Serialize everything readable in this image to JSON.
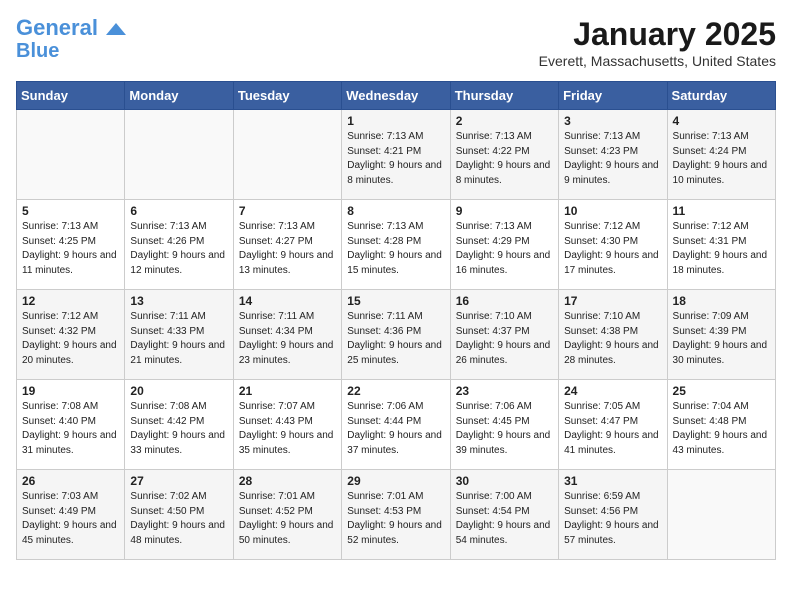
{
  "header": {
    "logo_line1": "General",
    "logo_line2": "Blue",
    "month_title": "January 2025",
    "location": "Everett, Massachusetts, United States"
  },
  "days_of_week": [
    "Sunday",
    "Monday",
    "Tuesday",
    "Wednesday",
    "Thursday",
    "Friday",
    "Saturday"
  ],
  "weeks": [
    [
      {
        "day": "",
        "content": ""
      },
      {
        "day": "",
        "content": ""
      },
      {
        "day": "",
        "content": ""
      },
      {
        "day": "1",
        "content": "Sunrise: 7:13 AM\nSunset: 4:21 PM\nDaylight: 9 hours and 8 minutes."
      },
      {
        "day": "2",
        "content": "Sunrise: 7:13 AM\nSunset: 4:22 PM\nDaylight: 9 hours and 8 minutes."
      },
      {
        "day": "3",
        "content": "Sunrise: 7:13 AM\nSunset: 4:23 PM\nDaylight: 9 hours and 9 minutes."
      },
      {
        "day": "4",
        "content": "Sunrise: 7:13 AM\nSunset: 4:24 PM\nDaylight: 9 hours and 10 minutes."
      }
    ],
    [
      {
        "day": "5",
        "content": "Sunrise: 7:13 AM\nSunset: 4:25 PM\nDaylight: 9 hours and 11 minutes."
      },
      {
        "day": "6",
        "content": "Sunrise: 7:13 AM\nSunset: 4:26 PM\nDaylight: 9 hours and 12 minutes."
      },
      {
        "day": "7",
        "content": "Sunrise: 7:13 AM\nSunset: 4:27 PM\nDaylight: 9 hours and 13 minutes."
      },
      {
        "day": "8",
        "content": "Sunrise: 7:13 AM\nSunset: 4:28 PM\nDaylight: 9 hours and 15 minutes."
      },
      {
        "day": "9",
        "content": "Sunrise: 7:13 AM\nSunset: 4:29 PM\nDaylight: 9 hours and 16 minutes."
      },
      {
        "day": "10",
        "content": "Sunrise: 7:12 AM\nSunset: 4:30 PM\nDaylight: 9 hours and 17 minutes."
      },
      {
        "day": "11",
        "content": "Sunrise: 7:12 AM\nSunset: 4:31 PM\nDaylight: 9 hours and 18 minutes."
      }
    ],
    [
      {
        "day": "12",
        "content": "Sunrise: 7:12 AM\nSunset: 4:32 PM\nDaylight: 9 hours and 20 minutes."
      },
      {
        "day": "13",
        "content": "Sunrise: 7:11 AM\nSunset: 4:33 PM\nDaylight: 9 hours and 21 minutes."
      },
      {
        "day": "14",
        "content": "Sunrise: 7:11 AM\nSunset: 4:34 PM\nDaylight: 9 hours and 23 minutes."
      },
      {
        "day": "15",
        "content": "Sunrise: 7:11 AM\nSunset: 4:36 PM\nDaylight: 9 hours and 25 minutes."
      },
      {
        "day": "16",
        "content": "Sunrise: 7:10 AM\nSunset: 4:37 PM\nDaylight: 9 hours and 26 minutes."
      },
      {
        "day": "17",
        "content": "Sunrise: 7:10 AM\nSunset: 4:38 PM\nDaylight: 9 hours and 28 minutes."
      },
      {
        "day": "18",
        "content": "Sunrise: 7:09 AM\nSunset: 4:39 PM\nDaylight: 9 hours and 30 minutes."
      }
    ],
    [
      {
        "day": "19",
        "content": "Sunrise: 7:08 AM\nSunset: 4:40 PM\nDaylight: 9 hours and 31 minutes."
      },
      {
        "day": "20",
        "content": "Sunrise: 7:08 AM\nSunset: 4:42 PM\nDaylight: 9 hours and 33 minutes."
      },
      {
        "day": "21",
        "content": "Sunrise: 7:07 AM\nSunset: 4:43 PM\nDaylight: 9 hours and 35 minutes."
      },
      {
        "day": "22",
        "content": "Sunrise: 7:06 AM\nSunset: 4:44 PM\nDaylight: 9 hours and 37 minutes."
      },
      {
        "day": "23",
        "content": "Sunrise: 7:06 AM\nSunset: 4:45 PM\nDaylight: 9 hours and 39 minutes."
      },
      {
        "day": "24",
        "content": "Sunrise: 7:05 AM\nSunset: 4:47 PM\nDaylight: 9 hours and 41 minutes."
      },
      {
        "day": "25",
        "content": "Sunrise: 7:04 AM\nSunset: 4:48 PM\nDaylight: 9 hours and 43 minutes."
      }
    ],
    [
      {
        "day": "26",
        "content": "Sunrise: 7:03 AM\nSunset: 4:49 PM\nDaylight: 9 hours and 45 minutes."
      },
      {
        "day": "27",
        "content": "Sunrise: 7:02 AM\nSunset: 4:50 PM\nDaylight: 9 hours and 48 minutes."
      },
      {
        "day": "28",
        "content": "Sunrise: 7:01 AM\nSunset: 4:52 PM\nDaylight: 9 hours and 50 minutes."
      },
      {
        "day": "29",
        "content": "Sunrise: 7:01 AM\nSunset: 4:53 PM\nDaylight: 9 hours and 52 minutes."
      },
      {
        "day": "30",
        "content": "Sunrise: 7:00 AM\nSunset: 4:54 PM\nDaylight: 9 hours and 54 minutes."
      },
      {
        "day": "31",
        "content": "Sunrise: 6:59 AM\nSunset: 4:56 PM\nDaylight: 9 hours and 57 minutes."
      },
      {
        "day": "",
        "content": ""
      }
    ]
  ]
}
